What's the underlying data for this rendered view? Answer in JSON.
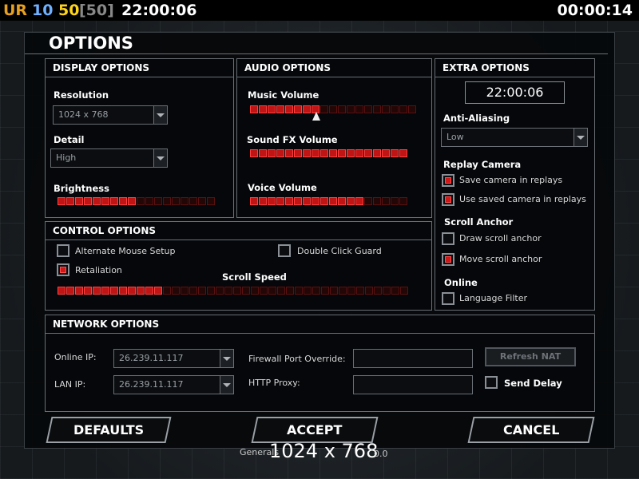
{
  "hud": {
    "ur": "UR",
    "num_blue": "10",
    "num_yellow": "50",
    "bracket": "[50]",
    "clock_left": "22:00:06",
    "clock_right": "00:00:14"
  },
  "dialog": {
    "title": "OPTIONS"
  },
  "display": {
    "header": "DISPLAY OPTIONS",
    "resolution_label": "Resolution",
    "resolution_value": "1024 x 768",
    "detail_label": "Detail",
    "detail_value": "High",
    "brightness_label": "Brightness",
    "brightness_level": 0.5
  },
  "audio": {
    "header": "AUDIO OPTIONS",
    "music_label": "Music Volume",
    "music_level": 0.4,
    "sfx_label": "Sound FX Volume",
    "sfx_level": 1.0,
    "voice_label": "Voice Volume",
    "voice_level": 0.7
  },
  "extra": {
    "header": "EXTRA OPTIONS",
    "clock": "22:00:06",
    "aa_label": "Anti-Aliasing",
    "aa_value": "Low",
    "replay_label": "Replay Camera",
    "save_cam": "Save camera in replays",
    "use_saved_cam": "Use saved camera in replays",
    "scroll_anchor_label": "Scroll Anchor",
    "draw_anchor": "Draw scroll anchor",
    "move_anchor": "Move scroll anchor",
    "online_label": "Online",
    "lang_filter": "Language Filter"
  },
  "control": {
    "header": "CONTROL OPTIONS",
    "alt_mouse": "Alternate Mouse Setup",
    "double_click": "Double Click Guard",
    "retaliation": "Retaliation",
    "scroll_speed_label": "Scroll Speed",
    "scroll_speed_level": 0.3
  },
  "network": {
    "header": "NETWORK OPTIONS",
    "online_ip_label": "Online IP:",
    "online_ip_value": "26.239.11.117",
    "lan_ip_label": "LAN IP:",
    "lan_ip_value": "26.239.11.117",
    "firewall_label": "Firewall Port Override:",
    "http_proxy_label": "HTTP Proxy:",
    "refresh_nat": "Refresh NAT",
    "send_delay": "Send Delay"
  },
  "buttons": {
    "defaults": "DEFAULTS",
    "accept": "ACCEPT",
    "cancel": "CANCEL"
  },
  "footer": {
    "version": "Generals",
    "resolution": "1024 x 768",
    "version_tail": "0.0"
  },
  "colors": {
    "accent_red": "#c01515",
    "bg": "#05070a",
    "border": "#6a7076"
  }
}
